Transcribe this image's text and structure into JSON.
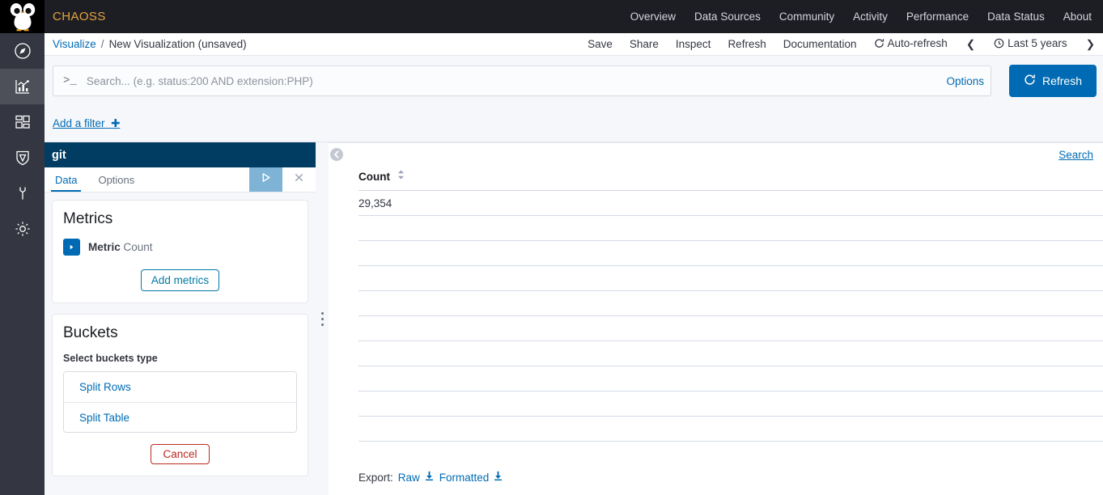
{
  "brand": {
    "name": "CHAOSS",
    "logo_icon": "owl-logo-icon"
  },
  "topnav": {
    "items": [
      {
        "label": "Overview"
      },
      {
        "label": "Data Sources"
      },
      {
        "label": "Community"
      },
      {
        "label": "Activity"
      },
      {
        "label": "Performance"
      },
      {
        "label": "Data Status"
      },
      {
        "label": "About"
      }
    ]
  },
  "breadcrumb": {
    "root": "Visualize",
    "separator": "/",
    "current": "New Visualization (unsaved)"
  },
  "actions": {
    "items": [
      {
        "label": "Save"
      },
      {
        "label": "Share"
      },
      {
        "label": "Inspect"
      },
      {
        "label": "Refresh"
      },
      {
        "label": "Documentation"
      }
    ],
    "auto_refresh": "Auto-refresh",
    "auto_refresh_icon": "refresh-icon",
    "time_range": "Last 5 years",
    "time_icon": "clock-icon",
    "prev_icon": "chevron-left-icon",
    "next_icon": "chevron-right-icon"
  },
  "query": {
    "prompt": ">_",
    "placeholder": "Search... (e.g. status:200 AND extension:PHP)",
    "value": "",
    "options_label": "Options",
    "refresh_label": "Refresh",
    "refresh_icon": "refresh-icon"
  },
  "filters": {
    "add_filter_label": "Add a filter",
    "add_icon": "plus-icon"
  },
  "rail": {
    "items": [
      {
        "name": "discover",
        "icon": "compass-icon",
        "active": false
      },
      {
        "name": "visualize",
        "icon": "chart-icon",
        "active": true
      },
      {
        "name": "dashboard",
        "icon": "dashboard-icon",
        "active": false
      },
      {
        "name": "security",
        "icon": "shield-icon",
        "active": false
      },
      {
        "name": "dev-tools",
        "icon": "wrench-icon",
        "active": false
      },
      {
        "name": "management",
        "icon": "gear-icon",
        "active": false
      }
    ]
  },
  "editor": {
    "title": "git",
    "tabs": [
      {
        "label": "Data",
        "selected": true
      },
      {
        "label": "Options",
        "selected": false
      }
    ],
    "apply_icon": "play-icon",
    "close_icon": "close-icon",
    "metrics": {
      "heading": "Metrics",
      "toggle_icon": "caret-right-icon",
      "agg_label": "Metric",
      "agg_value": "Count",
      "add_button": "Add metrics"
    },
    "buckets": {
      "heading": "Buckets",
      "select_label": "Select buckets type",
      "options": [
        {
          "label": "Split Rows"
        },
        {
          "label": "Split Table"
        }
      ],
      "cancel_button": "Cancel"
    }
  },
  "split_handle_icon": "drag-handle-icon",
  "viz": {
    "collapse_icon": "collapse-left-icon",
    "search_label": "Search",
    "table": {
      "columns": [
        {
          "label": "Count",
          "sort_icon": "sort-icon"
        }
      ],
      "rows": [
        [
          "29,354"
        ],
        [
          ""
        ],
        [
          ""
        ],
        [
          ""
        ],
        [
          ""
        ],
        [
          ""
        ],
        [
          ""
        ],
        [
          ""
        ],
        [
          ""
        ],
        [
          ""
        ]
      ]
    },
    "export": {
      "label": "Export:",
      "raw_label": "Raw",
      "formatted_label": "Formatted",
      "download_icon": "download-icon"
    }
  },
  "colors": {
    "brand_orange": "#e8a33d",
    "topbar_dark": "#1d1e24",
    "rail_dark": "#343741",
    "panel_navy": "#013c63",
    "link_blue": "#006bb4",
    "danger_red": "#bd271e",
    "play_blue": "#7eb3d6"
  }
}
